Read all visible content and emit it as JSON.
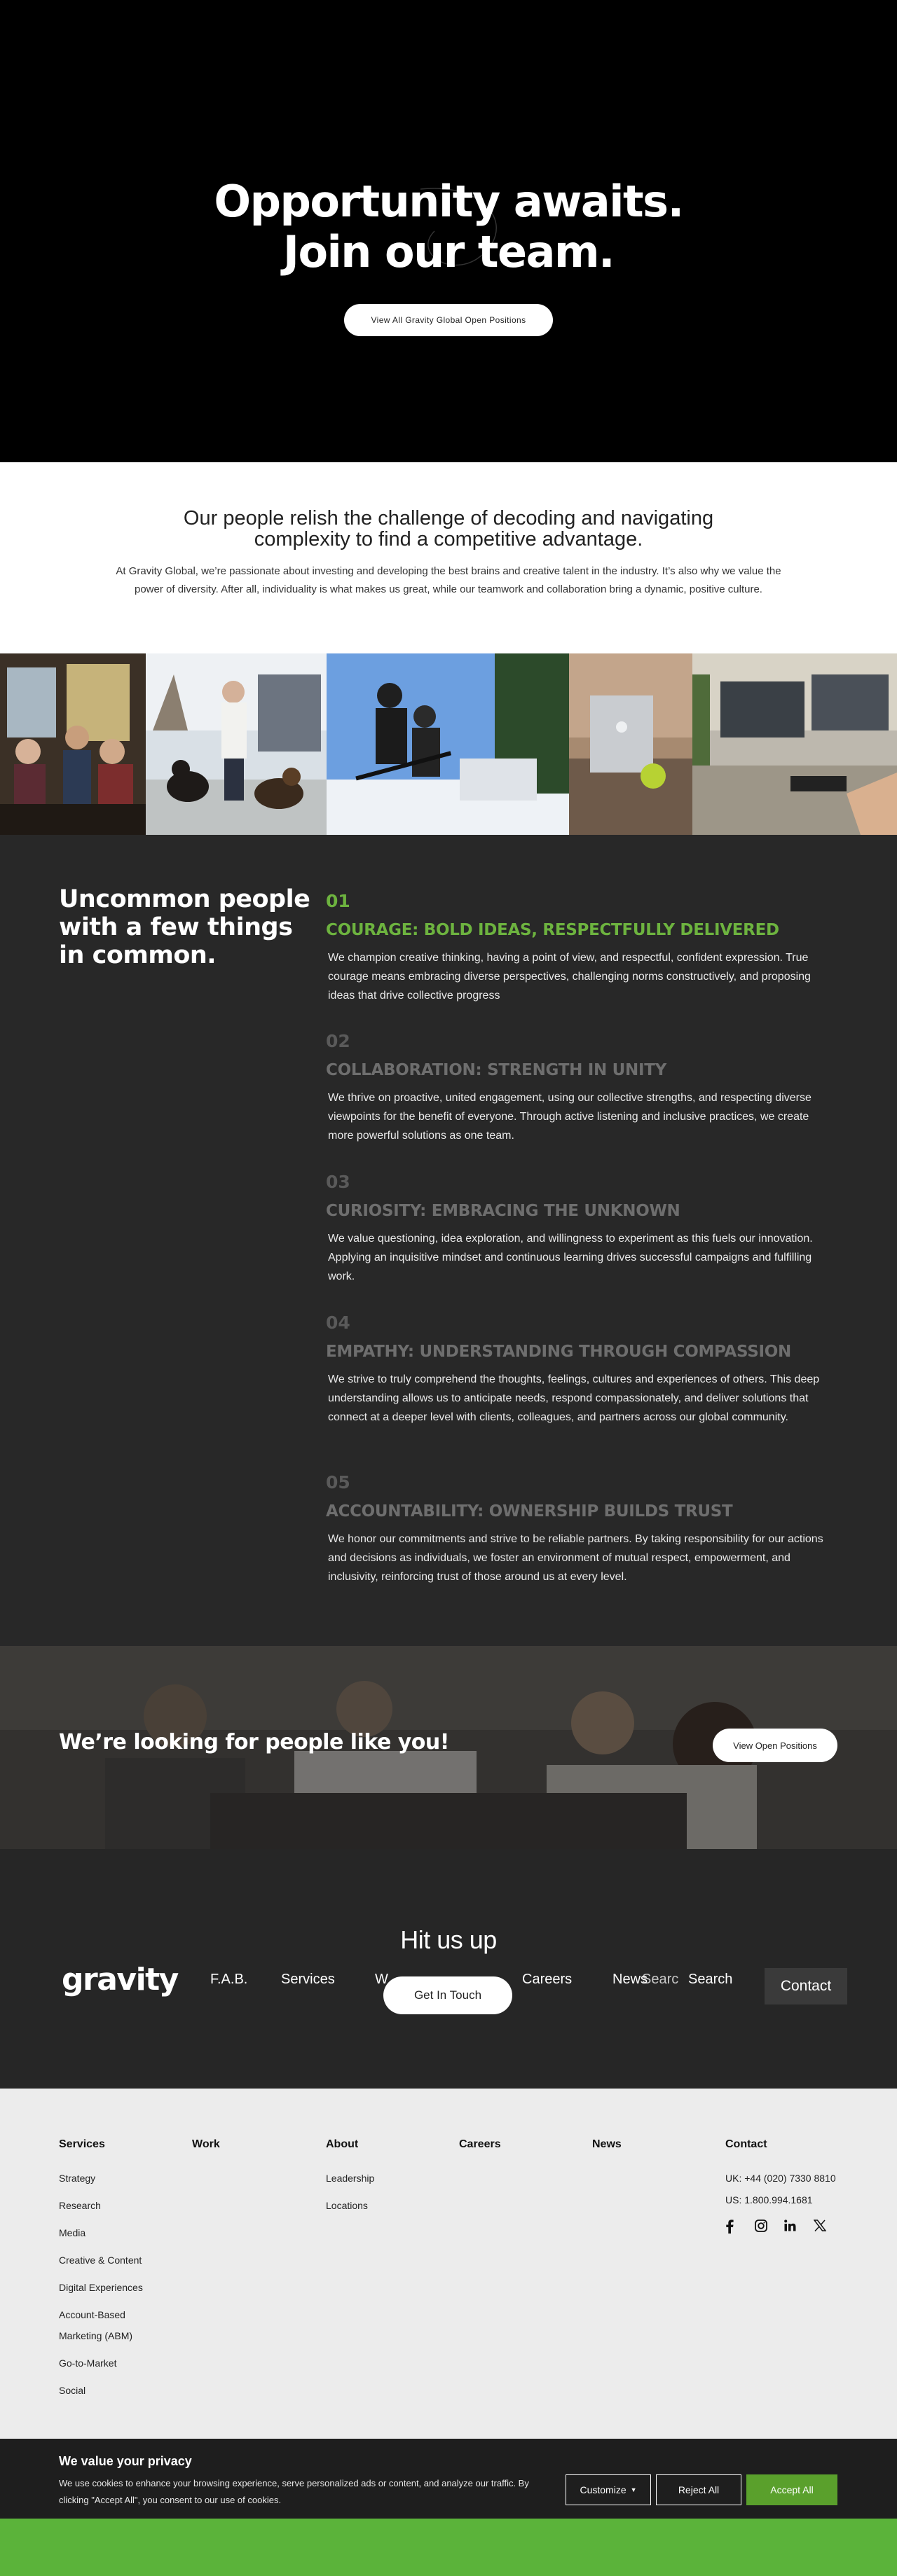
{
  "hero": {
    "title_line1": "Opportunity awaits.",
    "title_line2": "Join our team.",
    "button": "View All Gravity Global Open Positions"
  },
  "intro": {
    "heading": "Our people relish the challenge of decoding and navigating complexity to find a competitive advantage.",
    "body": "At Gravity Global, we’re passionate about investing and developing the best brains and creative talent in the industry. It’s also why we value the power of diversity. After all, individuality is what makes us great, while our teamwork and collaboration bring a dynamic, positive culture."
  },
  "photos": [
    {
      "name": "team-dinner-photo"
    },
    {
      "name": "dogs-walk-photo"
    },
    {
      "name": "ski-trip-photo"
    },
    {
      "name": "office-laptop-photo"
    },
    {
      "name": "workstation-photo"
    }
  ],
  "values": {
    "title": "Uncommon people with a few things in common.",
    "items": [
      {
        "num": "01",
        "head": "COURAGE: BOLD IDEAS, RESPECTFULLY DELIVERED",
        "desc": "We champion creative thinking, having a point of view, and respectful, confident expression. True courage means embracing diverse perspectives, challenging norms constructively, and proposing ideas that drive collective progress"
      },
      {
        "num": "02",
        "head": "COLLABORATION: STRENGTH IN UNITY",
        "desc": "We thrive on proactive, united engagement, using our collective strengths, and respecting diverse viewpoints for the benefit of everyone. Through active listening and inclusive practices, we create more powerful solutions as one team."
      },
      {
        "num": "03",
        "head": "CURIOSITY: EMBRACING THE UNKNOWN",
        "desc": "We value questioning, idea exploration, and willingness to experiment as this fuels our innovation. Applying an inquisitive mindset and continuous learning drives successful campaigns and fulfilling work."
      },
      {
        "num": "04",
        "head": "EMPATHY: UNDERSTANDING THROUGH COMPASSION",
        "desc": "We strive to truly comprehend the thoughts, feelings, cultures and experiences of others. This deep understanding allows us to anticipate needs, respond compassionately, and deliver solutions that connect at a deeper level with clients, colleagues, and partners across our global community."
      },
      {
        "num": "05",
        "head": "ACCOUNTABILITY: OWNERSHIP BUILDS TRUST",
        "desc": "We honor our commitments and strive to be reliable partners. By taking responsibility for our actions and decisions as individuals, we foster an environment of mutual respect, empowerment, and inclusivity, reinforcing trust of those around us at every level."
      }
    ]
  },
  "cta": {
    "text": "We’re looking for people like you!",
    "button": "View Open Positions"
  },
  "hit": {
    "title": "Hit us up",
    "logo": "gravity",
    "nav": [
      "F.A.B.",
      "Services",
      "W",
      "Careers",
      "News",
      "Search"
    ],
    "search_overlay": "Searc",
    "get_in_touch": "Get In Touch",
    "contact": "Contact"
  },
  "footer": {
    "services": {
      "title": "Services",
      "links": [
        "Strategy",
        "Research",
        "Media",
        "Creative & Content",
        "Digital Experiences",
        "Account-Based Marketing (ABM)",
        "Go-to-Market",
        "Social"
      ]
    },
    "work": {
      "title": "Work"
    },
    "about": {
      "title": "About",
      "links": [
        "Leadership",
        "Locations"
      ]
    },
    "careers": {
      "title": "Careers"
    },
    "news": {
      "title": "News"
    },
    "contact": {
      "title": "Contact",
      "uk": "UK: +44 (020) 7330 8810",
      "us": "US: 1.800.994.1681"
    },
    "socials": [
      "facebook-icon",
      "instagram-icon",
      "linkedin-icon",
      "x-icon"
    ]
  },
  "cookie": {
    "title": "We value your privacy",
    "text": "We use cookies to enhance your browsing experience, serve personalized ads or content, and analyze our traffic. By clicking \"Accept All\", you consent to our use of cookies.",
    "customize": "Customize",
    "reject": "Reject All",
    "accept": "Accept All"
  },
  "colors": {
    "accent_green": "#6db33f",
    "dark_bg": "#282828",
    "footer_bg": "#ececec"
  }
}
